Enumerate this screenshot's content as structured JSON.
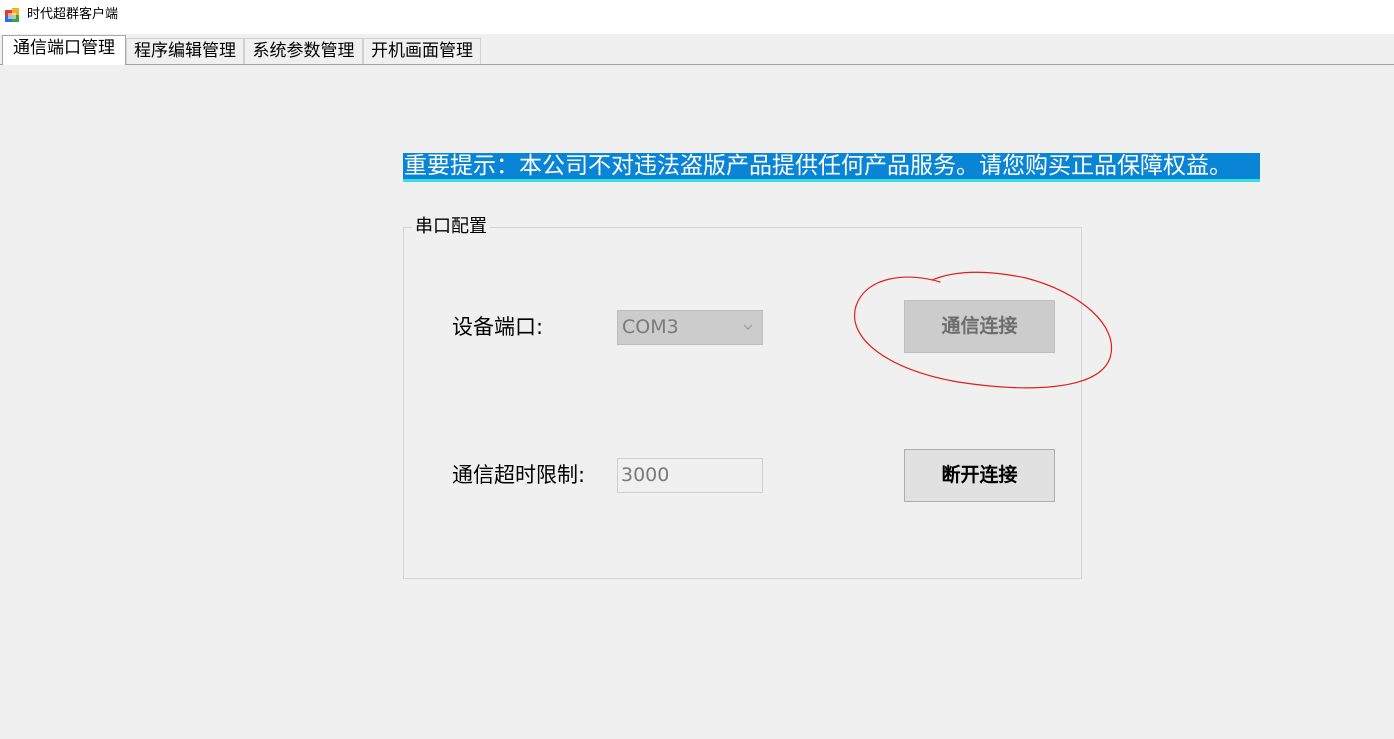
{
  "window": {
    "title": "时代超群客户端",
    "icon": "app-window-icon"
  },
  "tabs": [
    {
      "label": "通信端口管理",
      "active": true
    },
    {
      "label": "程序编辑管理",
      "active": false
    },
    {
      "label": "系统参数管理",
      "active": false
    },
    {
      "label": "开机画面管理",
      "active": false
    }
  ],
  "notice": {
    "text": "重要提示：本公司不对违法盗版产品提供任何产品服务。请您购买正品保障权益。"
  },
  "serial_config": {
    "group_title": "串口配置",
    "port_label": "设备端口:",
    "port_value": "COM3",
    "timeout_label": "通信超时限制:",
    "timeout_value": "3000",
    "connect_button": "通信连接",
    "disconnect_button": "断开连接"
  },
  "colors": {
    "notice_bg": "#0a84d4",
    "notice_underline": "#32e0e6",
    "annotation_stroke": "#e0201c",
    "panel_bg": "#f0f0f0"
  }
}
